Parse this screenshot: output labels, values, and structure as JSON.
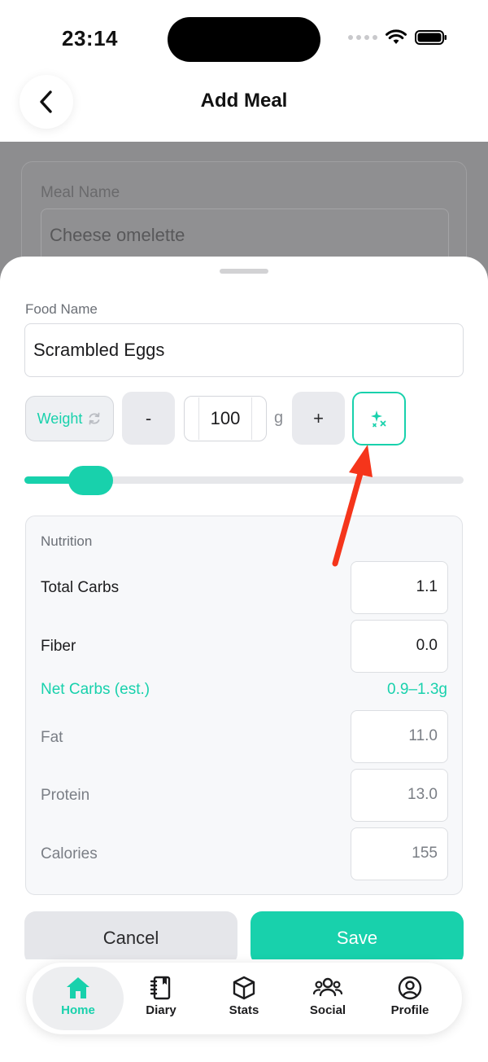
{
  "status_bar": {
    "time": "23:14"
  },
  "header": {
    "title": "Add Meal"
  },
  "background_form": {
    "meal_name_label": "Meal Name",
    "meal_name_value": "Cheese omelette"
  },
  "sheet": {
    "food_name_label": "Food Name",
    "food_name_value": "Scrambled Eggs",
    "weight_toggle_label": "Weight",
    "minus_label": "-",
    "plus_label": "+",
    "quantity_value": "100",
    "unit": "g",
    "slider_level": 0.15
  },
  "nutrition": {
    "title": "Nutrition",
    "rows": [
      {
        "label": "Total Carbs",
        "value": "1.1"
      },
      {
        "label": "Fiber",
        "value": "0.0"
      },
      {
        "label": "Fat",
        "value": "11.0"
      },
      {
        "label": "Protein",
        "value": "13.0"
      },
      {
        "label": "Calories",
        "value": "155"
      }
    ],
    "net_carbs_label": "Net Carbs (est.)",
    "net_carbs_value": "0.9–1.3g"
  },
  "actions": {
    "cancel_label": "Cancel",
    "save_label": "Save"
  },
  "tab_bar": {
    "tabs": [
      {
        "label": "Home",
        "icon": "home-icon",
        "active": true
      },
      {
        "label": "Diary",
        "icon": "notebook-icon"
      },
      {
        "label": "Stats",
        "icon": "cube-icon"
      },
      {
        "label": "Social",
        "icon": "users-icon"
      },
      {
        "label": "Profile",
        "icon": "user-circle-icon"
      }
    ]
  },
  "colors": {
    "accent": "#18d1ac",
    "annotation_arrow": "#f5351b"
  }
}
